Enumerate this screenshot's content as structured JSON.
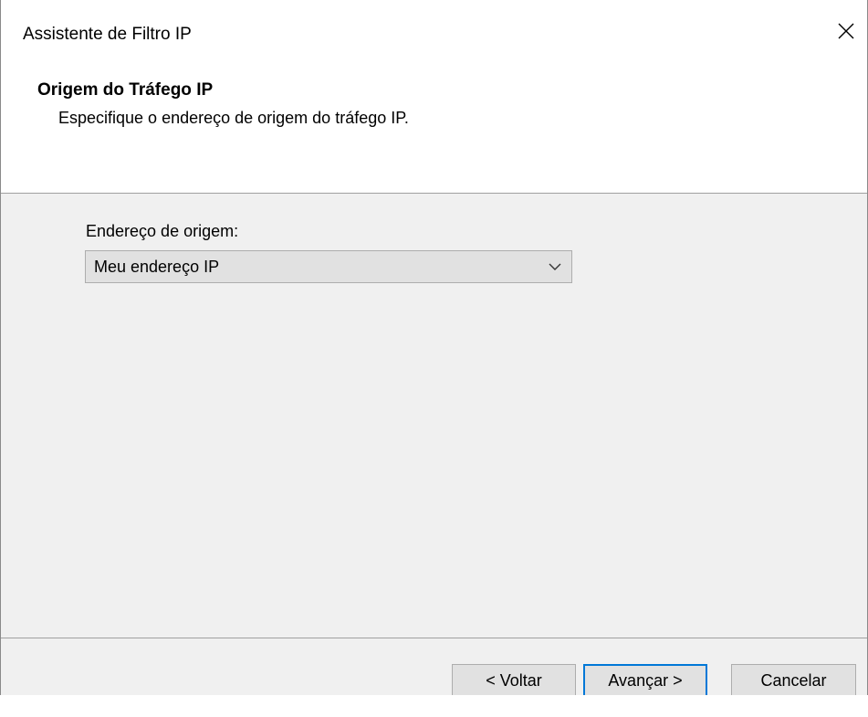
{
  "window": {
    "title": "Assistente de Filtro IP",
    "close_symbol": "✕"
  },
  "header": {
    "title": "Origem do Tráfego IP",
    "subtitle": "Especifique o endereço de origem do tráfego IP."
  },
  "form": {
    "source_label": "Endereço de origem:",
    "source_value": "Meu endereço IP"
  },
  "footer": {
    "back_label": "< Voltar",
    "next_label": "Avançar >",
    "cancel_label": "Cancelar"
  },
  "colors": {
    "accent": "#0078d7",
    "panel_bg": "#f0f0f0",
    "button_bg": "#e1e1e1"
  },
  "icons": {
    "close": "close-icon",
    "dropdown": "chevron-down-icon"
  }
}
